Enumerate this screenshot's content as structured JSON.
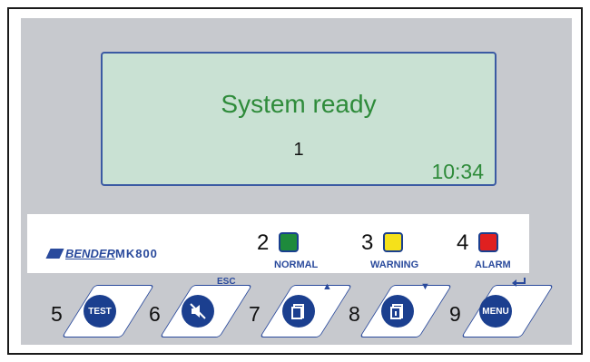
{
  "lcd": {
    "message": "System ready",
    "number": "1",
    "time": "10:34"
  },
  "brand": {
    "name": "BENDER",
    "model": "MK800"
  },
  "leds": [
    {
      "number": "2",
      "label": "NORMAL",
      "color": "#1e8a3c"
    },
    {
      "number": "3",
      "label": "WARNING",
      "color": "#f5e11a"
    },
    {
      "number": "4",
      "label": "ALARM",
      "color": "#e02020"
    }
  ],
  "keys": [
    {
      "number": "5",
      "label": "TEST",
      "icon": "test-text"
    },
    {
      "number": "6",
      "label": "ESC",
      "icon": "mute-speaker-icon"
    },
    {
      "number": "7",
      "label": "",
      "icon": "page-up-icon"
    },
    {
      "number": "8",
      "label": "",
      "icon": "page-info-down-icon"
    },
    {
      "number": "9",
      "label": "MENU",
      "icon": "enter-icon"
    }
  ]
}
